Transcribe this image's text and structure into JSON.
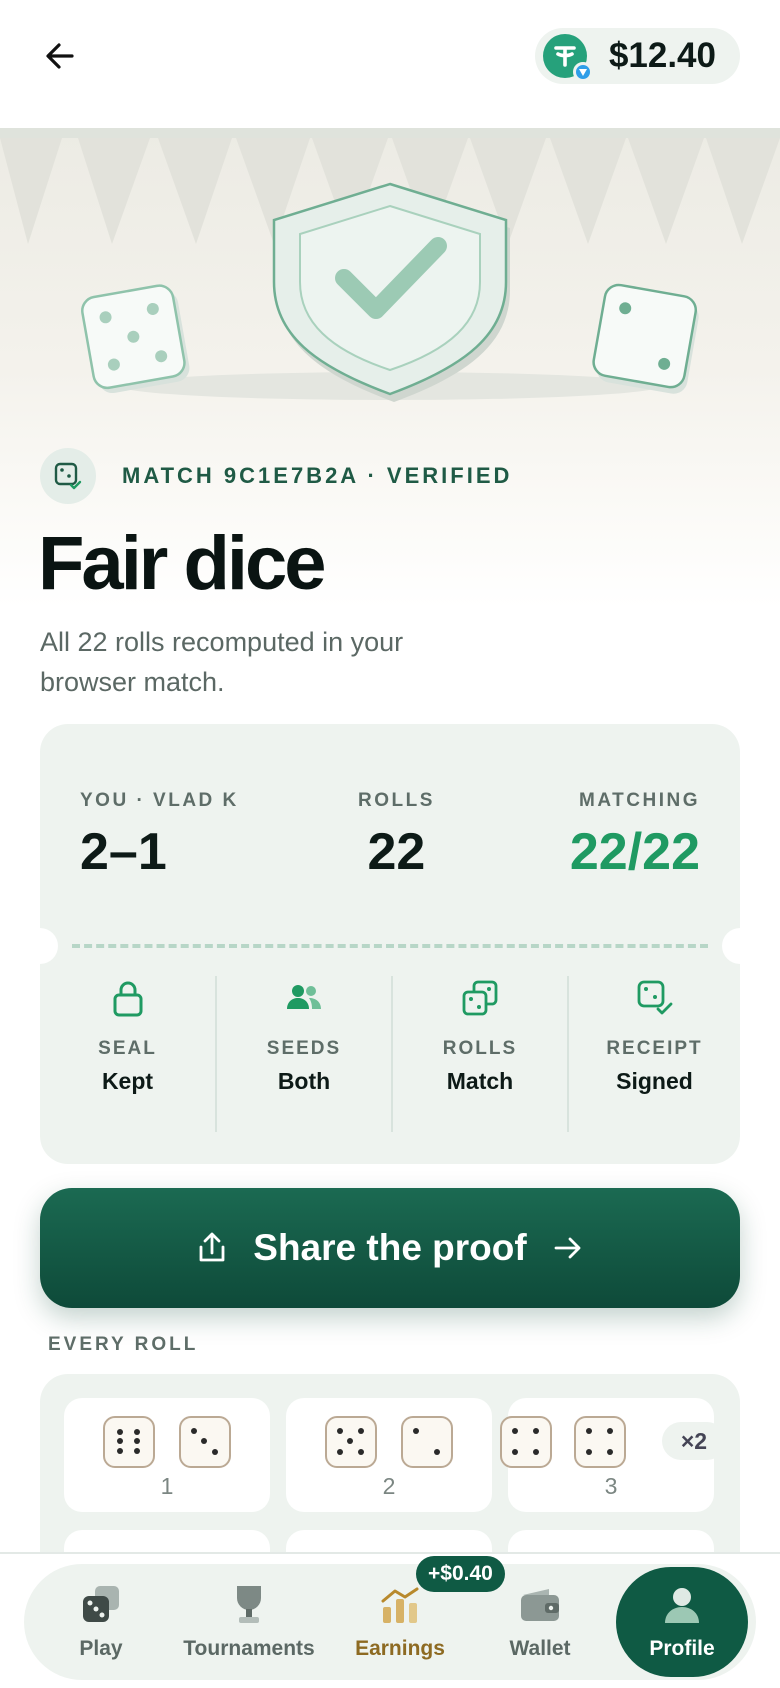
{
  "header": {
    "balance": "$12.40",
    "token_icon": "tether-icon",
    "network_icon": "ton-icon"
  },
  "match": {
    "label": "MATCH 9C1E7B2A · VERIFIED",
    "title": "Fair dice",
    "subtitle": "All 22 rolls recomputed in your browser match."
  },
  "summary": {
    "stats": [
      {
        "label": "YOU · VLAD K",
        "value": "2–1"
      },
      {
        "label": "ROLLS",
        "value": "22"
      },
      {
        "label": "MATCHING",
        "value": "22/22"
      }
    ],
    "checks": [
      {
        "icon": "lock-icon",
        "label": "SEAL",
        "value": "Kept"
      },
      {
        "icon": "users-icon",
        "label": "SEEDS",
        "value": "Both"
      },
      {
        "icon": "dice-icon",
        "label": "ROLLS",
        "value": "Match"
      },
      {
        "icon": "die-check-icon",
        "label": "RECEIPT",
        "value": "Signed"
      }
    ]
  },
  "share": {
    "label": "Share the proof"
  },
  "rolls": {
    "title": "EVERY ROLL",
    "items": [
      {
        "num": "1",
        "dice": [
          6,
          3
        ]
      },
      {
        "num": "2",
        "dice": [
          5,
          2
        ]
      },
      {
        "num": "3",
        "dice": [
          4,
          4
        ],
        "multiplier": "×2"
      }
    ]
  },
  "nav": {
    "items": [
      {
        "label": "Play",
        "icon": "dice-icon"
      },
      {
        "label": "Tournaments",
        "icon": "trophy-icon"
      },
      {
        "label": "Earnings",
        "icon": "earnings-icon",
        "badge": "+$0.40"
      },
      {
        "label": "Wallet",
        "icon": "wallet-icon"
      },
      {
        "label": "Profile",
        "icon": "profile-icon"
      }
    ]
  },
  "colors": {
    "accent": "#0f5a44",
    "success": "#1f9a62",
    "earnings": "#8d6a22"
  }
}
